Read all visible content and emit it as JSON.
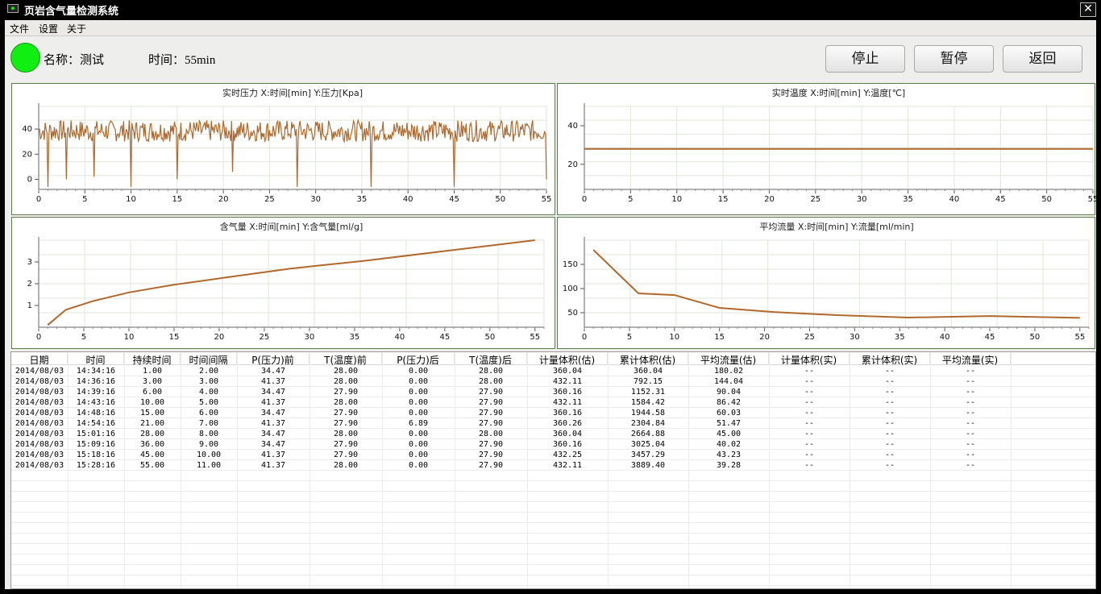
{
  "window": {
    "title": "页岩含气量检测系统",
    "close_label": "✕"
  },
  "menu": {
    "items": [
      "文件",
      "设置",
      "关于"
    ]
  },
  "status": {
    "name_label": "名称：测试",
    "time_label": "时间：55min",
    "led_color": "#11ee11"
  },
  "toolbar": {
    "stop_label": "停止",
    "pause_label": "暂停",
    "back_label": "返回"
  },
  "chart_data": [
    {
      "type": "line",
      "title": "实时压力 X:时间[min] Y:压力[Kpa]",
      "xlim": [
        0,
        55
      ],
      "ylim": [
        -8,
        58
      ],
      "xticks": [
        0,
        5,
        10,
        15,
        20,
        25,
        30,
        35,
        40,
        45,
        50,
        55
      ],
      "yticks": [
        0,
        20,
        40
      ],
      "grid": true,
      "series": [
        {
          "color": "#b0682c",
          "noisy_band": [
            30,
            47
          ],
          "dips": [
            [
              1.0,
              -6
            ],
            [
              3.0,
              0
            ],
            [
              6.0,
              2
            ],
            [
              10.0,
              -6
            ],
            [
              15.0,
              0
            ],
            [
              21.0,
              6
            ],
            [
              28.0,
              -6
            ],
            [
              36.0,
              -6
            ],
            [
              45.0,
              -6
            ],
            [
              55.0,
              0
            ]
          ]
        }
      ]
    },
    {
      "type": "line",
      "title": "实时温度 X:时间[min] Y:温度[℃]",
      "xlim": [
        0,
        55
      ],
      "ylim": [
        7,
        50
      ],
      "xticks": [
        0,
        5,
        10,
        15,
        20,
        25,
        30,
        35,
        40,
        45,
        50,
        55
      ],
      "yticks": [
        20,
        40
      ],
      "grid": true,
      "series": [
        {
          "color": "#b0682c",
          "x": [
            0,
            55
          ],
          "y": [
            28,
            28
          ]
        }
      ]
    },
    {
      "type": "line",
      "title": "含气量 X:时间[min] Y:含气量[ml/g]",
      "xlim": [
        0,
        56
      ],
      "ylim": [
        0,
        4
      ],
      "xticks": [
        0,
        5,
        10,
        15,
        20,
        25,
        30,
        35,
        40,
        45,
        50,
        55
      ],
      "yticks": [
        1,
        2,
        3
      ],
      "grid": true,
      "series": [
        {
          "color": "#b0682c",
          "x": [
            1,
            3,
            6,
            10,
            15,
            21,
            28,
            36,
            45,
            55
          ],
          "y": [
            0.1,
            0.8,
            1.2,
            1.6,
            1.95,
            2.3,
            2.7,
            3.05,
            3.5,
            4.0
          ]
        }
      ]
    },
    {
      "type": "line",
      "title": "平均流量 X:时间[min] Y:流量[ml/min]",
      "xlim": [
        0,
        56
      ],
      "ylim": [
        20,
        200
      ],
      "xticks": [
        0,
        5,
        10,
        15,
        20,
        25,
        30,
        35,
        40,
        45,
        50,
        55
      ],
      "yticks": [
        50,
        100,
        150
      ],
      "grid": true,
      "series": [
        {
          "color": "#b0682c",
          "x": [
            1,
            6,
            10,
            15,
            21,
            28,
            36,
            45,
            55
          ],
          "y": [
            180.02,
            90.04,
            86.42,
            60.03,
            51.47,
            45.0,
            40.02,
            43.23,
            39.28
          ]
        }
      ]
    }
  ],
  "table": {
    "headers": [
      "日期",
      "时间",
      "持续时间",
      "时间间隔",
      "P(压力)前",
      "T(温度)前",
      "P(压力)后",
      "T(温度)后",
      "计量体积(估)",
      "累计体积(估)",
      "平均流量(估)",
      "计量体积(实)",
      "累计体积(实)",
      "平均流量(实)"
    ],
    "rows": [
      [
        "2014/08/03",
        "14:34:16",
        "1.00",
        "2.00",
        "34.47",
        "28.00",
        "0.00",
        "28.00",
        "360.04",
        "360.04",
        "180.02",
        "--",
        "--",
        "--"
      ],
      [
        "2014/08/03",
        "14:36:16",
        "3.00",
        "3.00",
        "41.37",
        "28.00",
        "0.00",
        "28.00",
        "432.11",
        "792.15",
        "144.04",
        "--",
        "--",
        "--"
      ],
      [
        "2014/08/03",
        "14:39:16",
        "6.00",
        "4.00",
        "34.47",
        "27.90",
        "0.00",
        "27.90",
        "360.16",
        "1152.31",
        "90.04",
        "--",
        "--",
        "--"
      ],
      [
        "2014/08/03",
        "14:43:16",
        "10.00",
        "5.00",
        "41.37",
        "28.00",
        "0.00",
        "27.90",
        "432.11",
        "1584.42",
        "86.42",
        "--",
        "--",
        "--"
      ],
      [
        "2014/08/03",
        "14:48:16",
        "15.00",
        "6.00",
        "34.47",
        "27.90",
        "0.00",
        "27.90",
        "360.16",
        "1944.58",
        "60.03",
        "--",
        "--",
        "--"
      ],
      [
        "2014/08/03",
        "14:54:16",
        "21.00",
        "7.00",
        "41.37",
        "27.90",
        "6.89",
        "27.90",
        "360.26",
        "2304.84",
        "51.47",
        "--",
        "--",
        "--"
      ],
      [
        "2014/08/03",
        "15:01:16",
        "28.00",
        "8.00",
        "34.47",
        "28.00",
        "0.00",
        "28.00",
        "360.04",
        "2664.88",
        "45.00",
        "--",
        "--",
        "--"
      ],
      [
        "2014/08/03",
        "15:09:16",
        "36.00",
        "9.00",
        "34.47",
        "27.90",
        "0.00",
        "27.90",
        "360.16",
        "3025.04",
        "40.02",
        "--",
        "--",
        "--"
      ],
      [
        "2014/08/03",
        "15:18:16",
        "45.00",
        "10.00",
        "41.37",
        "27.90",
        "0.00",
        "27.90",
        "432.25",
        "3457.29",
        "43.23",
        "--",
        "--",
        "--"
      ],
      [
        "2014/08/03",
        "15:28:16",
        "55.00",
        "11.00",
        "41.37",
        "28.00",
        "0.00",
        "27.90",
        "432.11",
        "3889.40",
        "39.28",
        "--",
        "--",
        "--"
      ]
    ]
  }
}
